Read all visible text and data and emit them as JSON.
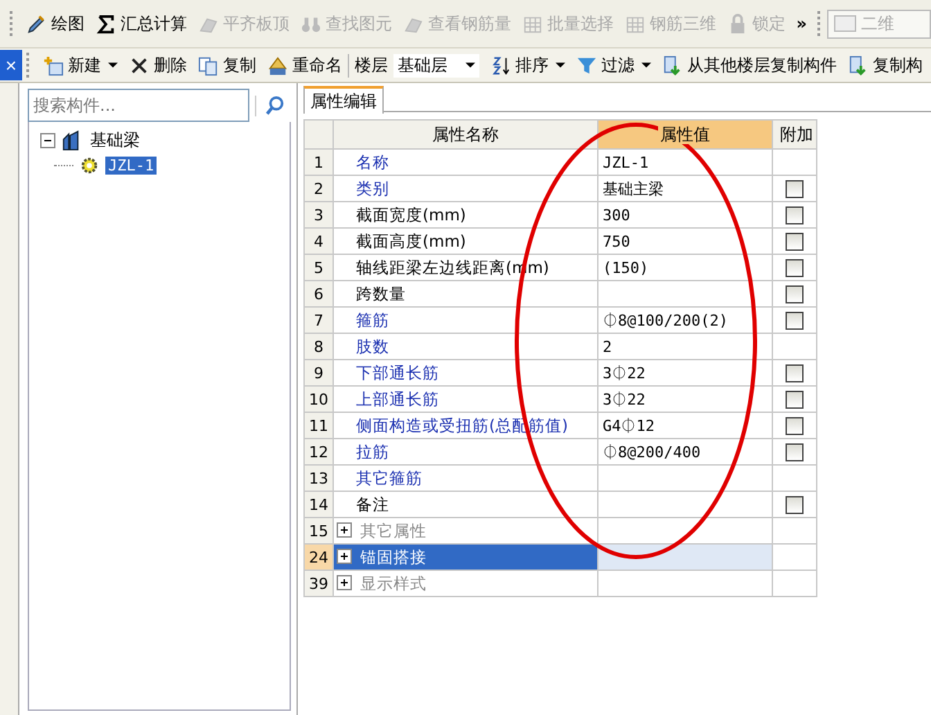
{
  "toolbar": [
    {
      "label": "绘图",
      "disabled": false
    },
    {
      "label": "汇总计算",
      "disabled": false
    },
    {
      "label": "平齐板顶",
      "disabled": true
    },
    {
      "label": "查找图元",
      "disabled": true
    },
    {
      "label": "查看钢筋量",
      "disabled": true
    },
    {
      "label": "批量选择",
      "disabled": true
    },
    {
      "label": "钢筋三维",
      "disabled": true
    },
    {
      "label": "锁定",
      "disabled": true
    }
  ],
  "toolbar_overflow": "»",
  "view_dropdown": {
    "value": "二维",
    "disabled": true
  },
  "close_symbol": "×",
  "toolbar2": [
    {
      "kind": "button",
      "label": "新建",
      "menu": true
    },
    {
      "kind": "button",
      "label": "删除",
      "menu": false
    },
    {
      "kind": "button",
      "label": "复制",
      "menu": false
    },
    {
      "kind": "button",
      "label": "重命名",
      "menu": false
    },
    {
      "kind": "label",
      "label": "楼层"
    },
    {
      "kind": "dropdown",
      "label": "基础层"
    },
    {
      "kind": "button",
      "label": "排序",
      "menu": true
    },
    {
      "kind": "button",
      "label": "过滤",
      "menu": true
    },
    {
      "kind": "button",
      "label": "从其他楼层复制构件",
      "menu": false
    },
    {
      "kind": "button",
      "label": "复制构",
      "menu": false
    }
  ],
  "search": {
    "placeholder": "搜索构件..."
  },
  "tree": [
    {
      "label": "基础梁",
      "expanded": true,
      "selected": false,
      "children": [
        {
          "label": "JZL-1",
          "selected": true
        }
      ]
    }
  ],
  "tab": {
    "label": "属性编辑",
    "selected": true
  },
  "table": {
    "columns": [
      "属性名称",
      "属性值",
      "附加"
    ],
    "rows": [
      {
        "index": "1",
        "name": "名称",
        "value": "JZL-1",
        "kind": "public",
        "selected": false
      },
      {
        "index": "2",
        "name": "类别",
        "value": "基础主梁",
        "kind": "public",
        "selected": false,
        "attached": false
      },
      {
        "index": "3",
        "name": "截面宽度(mm)",
        "value": "300",
        "kind": "private",
        "selected": false,
        "attached": false
      },
      {
        "index": "4",
        "name": "截面高度(mm)",
        "value": "750",
        "kind": "private",
        "selected": false,
        "attached": false
      },
      {
        "index": "5",
        "name": "轴线距梁左边线距离(mm)",
        "value": "(150)",
        "kind": "private",
        "selected": false,
        "attached": false
      },
      {
        "index": "6",
        "name": "跨数量",
        "value": "",
        "kind": "private",
        "selected": false,
        "attached": false
      },
      {
        "index": "7",
        "name": "箍筋",
        "value": "⏀8@100/200(2)",
        "kind": "public",
        "selected": false,
        "attached": false
      },
      {
        "index": "8",
        "name": "肢数",
        "value": "2",
        "kind": "public",
        "selected": false
      },
      {
        "index": "9",
        "name": "下部通长筋",
        "value": "3⏀22",
        "kind": "public",
        "selected": false,
        "attached": false
      },
      {
        "index": "10",
        "name": "上部通长筋",
        "value": "3⏀22",
        "kind": "public",
        "selected": false,
        "attached": false
      },
      {
        "index": "11",
        "name": "侧面构造或受扭筋(总配筋值)",
        "value": "G4⏀12",
        "kind": "public",
        "selected": false,
        "attached": false
      },
      {
        "index": "12",
        "name": "拉筋",
        "value": "⏀8@200/400",
        "kind": "public",
        "selected": false,
        "attached": false
      },
      {
        "index": "13",
        "name": "其它箍筋",
        "value": "",
        "kind": "public",
        "selected": false
      },
      {
        "index": "14",
        "name": "备注",
        "value": "",
        "kind": "private",
        "selected": false,
        "attached": false
      },
      {
        "index": "15",
        "name": "其它属性",
        "value": "",
        "kind": "group",
        "expanded": false,
        "selected": false
      },
      {
        "index": "24",
        "name": "锚固搭接",
        "value": "",
        "kind": "group",
        "expanded": false,
        "selected": true
      },
      {
        "index": "39",
        "name": "显示样式",
        "value": "",
        "kind": "group",
        "expanded": false,
        "selected": false
      }
    ]
  }
}
